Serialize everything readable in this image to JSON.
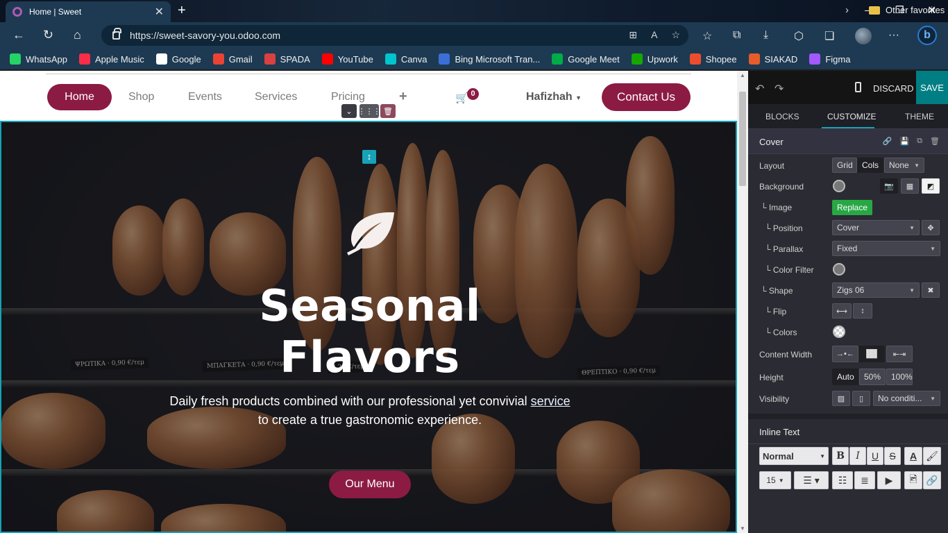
{
  "browser": {
    "tab_title": "Home | Sweet",
    "url": "https://sweet-savory-you.odoo.com",
    "bookmarks": [
      {
        "label": "WhatsApp",
        "color": "#25d366"
      },
      {
        "label": "Apple Music",
        "color": "#fa2d48"
      },
      {
        "label": "Google",
        "color": "#ffffff"
      },
      {
        "label": "Gmail",
        "color": "#ea4335"
      },
      {
        "label": "SPADA",
        "color": "#d94040"
      },
      {
        "label": "YouTube",
        "color": "#ff0000"
      },
      {
        "label": "Canva",
        "color": "#00c4cc"
      },
      {
        "label": "Bing Microsoft Tran...",
        "color": "#3b6fd6"
      },
      {
        "label": "Google Meet",
        "color": "#00ac47"
      },
      {
        "label": "Upwork",
        "color": "#14a800"
      },
      {
        "label": "Shopee",
        "color": "#ee4d2d"
      },
      {
        "label": "SIAKAD",
        "color": "#e85c2a"
      },
      {
        "label": "Figma",
        "color": "#a259ff"
      }
    ],
    "other_favorites": "Other favorites"
  },
  "site": {
    "nav": {
      "home": "Home",
      "shop": "Shop",
      "events": "Events",
      "services": "Services",
      "pricing": "Pricing",
      "add": "+",
      "cart_count": "0",
      "user": "Hafizhah",
      "contact": "Contact Us"
    },
    "hero": {
      "title_line1": "Seasonal",
      "title_line2": "Flavors",
      "subtitle_line1_prefix": "Daily fresh products combined with our professional yet convivial ",
      "subtitle_link": "service",
      "subtitle_line2": "to create a true gastronomic experience.",
      "cta": "Our Menu"
    }
  },
  "editor": {
    "discard": "DISCARD",
    "save": "SAVE",
    "tabs": [
      "BLOCKS",
      "CUSTOMIZE",
      "THEME"
    ],
    "active_tab": "CUSTOMIZE",
    "section_title": "Cover",
    "rows": {
      "layout": "Layout",
      "layout_grid": "Grid",
      "layout_cols": "Cols",
      "layout_none": "None",
      "background": "Background",
      "image": "Image",
      "replace": "Replace",
      "position": "Position",
      "position_value": "Cover",
      "parallax": "Parallax",
      "parallax_value": "Fixed",
      "color_filter": "Color Filter",
      "shape": "Shape",
      "shape_value": "Zigs 06",
      "flip": "Flip",
      "colors": "Colors",
      "content_width": "Content Width",
      "height": "Height",
      "height_auto": "Auto",
      "height_50": "50%",
      "height_100": "100%",
      "visibility": "Visibility",
      "visibility_value": "No conditi..."
    },
    "inline_text": {
      "title": "Inline Text",
      "style": "Normal",
      "size": "15",
      "bold": "B",
      "italic": "I",
      "underline": "U",
      "strike": "S"
    }
  },
  "colors": {
    "brand": "#8c1b43",
    "accent": "#017e84",
    "selection": "#17a2b8"
  }
}
